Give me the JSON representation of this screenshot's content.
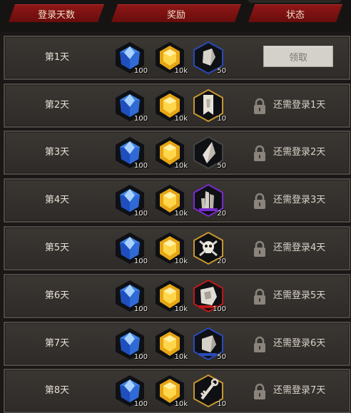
{
  "header": {
    "days_label": "登录天数",
    "reward_label": "奖励",
    "status_label": "状态"
  },
  "rows": [
    {
      "day": "第1天",
      "gem_qty": "100",
      "gold_qty": "10k",
      "item_qty": "50",
      "status": "",
      "claim_label": "领取"
    },
    {
      "day": "第2天",
      "gem_qty": "100",
      "gold_qty": "10k",
      "item_qty": "10",
      "status": "还需登录1天"
    },
    {
      "day": "第3天",
      "gem_qty": "100",
      "gold_qty": "10k",
      "item_qty": "50",
      "status": "还需登录2天"
    },
    {
      "day": "第4天",
      "gem_qty": "100",
      "gold_qty": "10k",
      "item_qty": "20",
      "status": "还需登录3天"
    },
    {
      "day": "第5天",
      "gem_qty": "100",
      "gold_qty": "10k",
      "item_qty": "20",
      "status": "还需登录4天"
    },
    {
      "day": "第6天",
      "gem_qty": "100",
      "gold_qty": "10k",
      "item_qty": "100",
      "status": "还需登录5天"
    },
    {
      "day": "第7天",
      "gem_qty": "100",
      "gold_qty": "10k",
      "item_qty": "50",
      "status": "还需登录6天"
    },
    {
      "day": "第8天",
      "gem_qty": "100",
      "gold_qty": "10k",
      "item_qty": "10",
      "status": "还需登录7天"
    }
  ],
  "icons": {
    "gem": "blue-crystal-icon",
    "gold": "gold-gem-icon",
    "items": [
      "stone-shard-icon",
      "banner-scroll-icon",
      "white-crystal-icon",
      "purple-crystal-cluster-icon",
      "skull-crossbones-icon",
      "ore-rock-icon",
      "rock-chunk-icon",
      "golden-key-icon"
    ]
  },
  "colors": {
    "header_red": "#7a1010",
    "item_border_blue": "#2a4ab8",
    "item_border_gold": "#c8962e",
    "item_border_purple": "#7a2ad0",
    "item_border_red": "#c01818",
    "item_border_gray": "#444444"
  }
}
